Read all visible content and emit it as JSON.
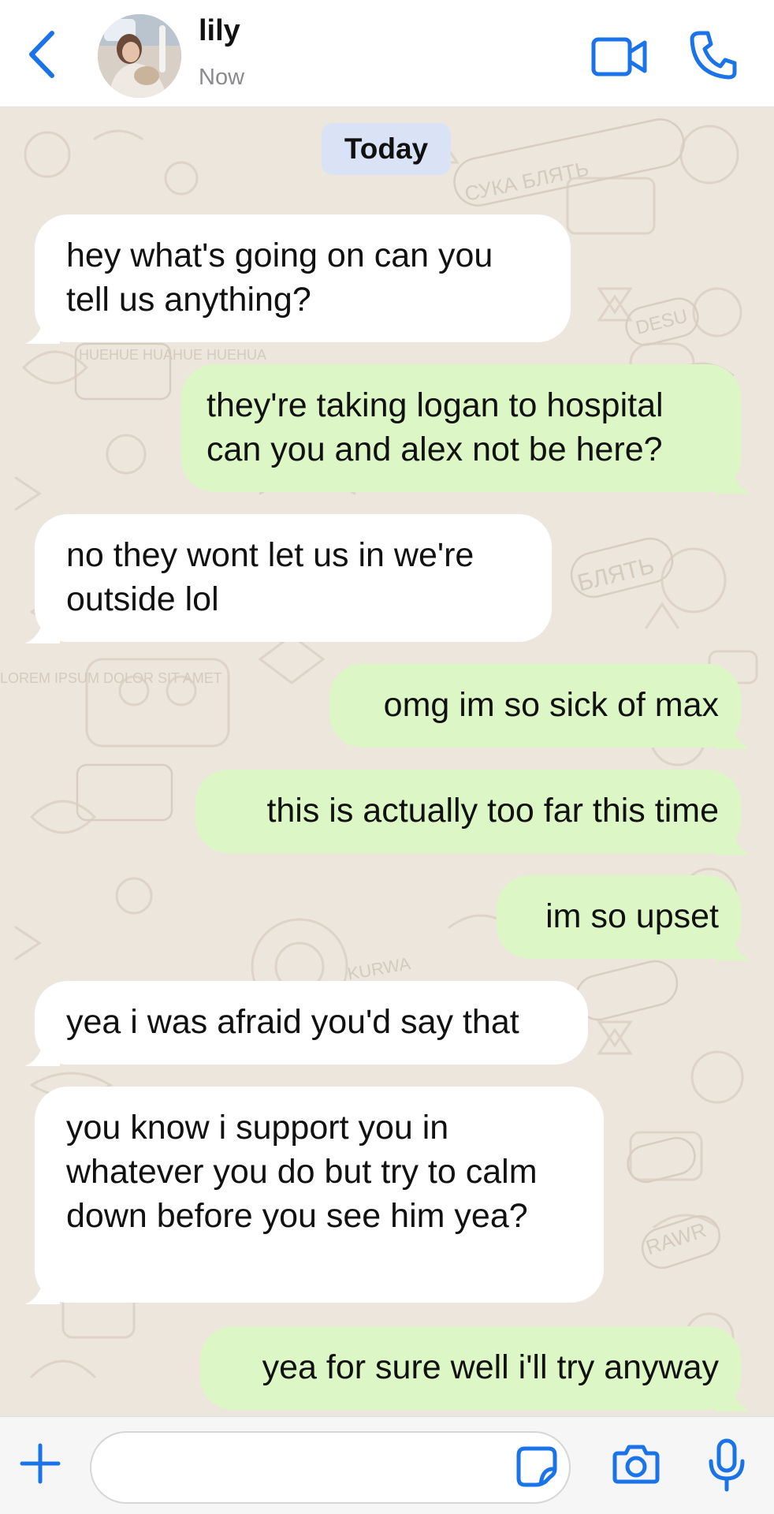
{
  "header": {
    "back_icon": "chevron-left-icon",
    "contact_name": "lily",
    "status": "Now",
    "video_icon": "video-camera-icon",
    "call_icon": "phone-icon",
    "accent_color": "#1a73e8"
  },
  "chat": {
    "date_separator": "Today",
    "wallpaper_labels": [
      "СУКА БЛЯТЬ",
      "DESU",
      "HUEHUE HUAHUE HUEHUA",
      "LOREM IPSUM DOLOR SIT AMET",
      "БЛЯТЬ",
      "RAWR",
      "KURWA"
    ],
    "messages": [
      {
        "direction": "in",
        "text": "hey what's going on can you\ntell us anything?"
      },
      {
        "direction": "out",
        "text": "they're taking logan to hospital\ncan you and alex not be here?"
      },
      {
        "direction": "in",
        "text": "no they wont let us in we're\noutside lol"
      },
      {
        "direction": "out",
        "text": "omg im so sick of max"
      },
      {
        "direction": "out",
        "text": "this is actually too far this time"
      },
      {
        "direction": "out",
        "text": "im so upset"
      },
      {
        "direction": "in",
        "text": "yea i was afraid you'd say that"
      },
      {
        "direction": "in",
        "text": "you know i support you in\nwhatever you do but try to calm\ndown before you see him yea?"
      },
      {
        "direction": "out",
        "text": "yea for sure well i'll try anyway"
      }
    ],
    "incoming_color": "#ffffff",
    "outgoing_color": "#dcf6c6",
    "background_color": "#ede6dd"
  },
  "input_bar": {
    "plus_icon": "plus-icon",
    "input_value": "",
    "sticker_icon": "sticker-icon",
    "camera_icon": "camera-icon",
    "mic_icon": "microphone-icon"
  }
}
